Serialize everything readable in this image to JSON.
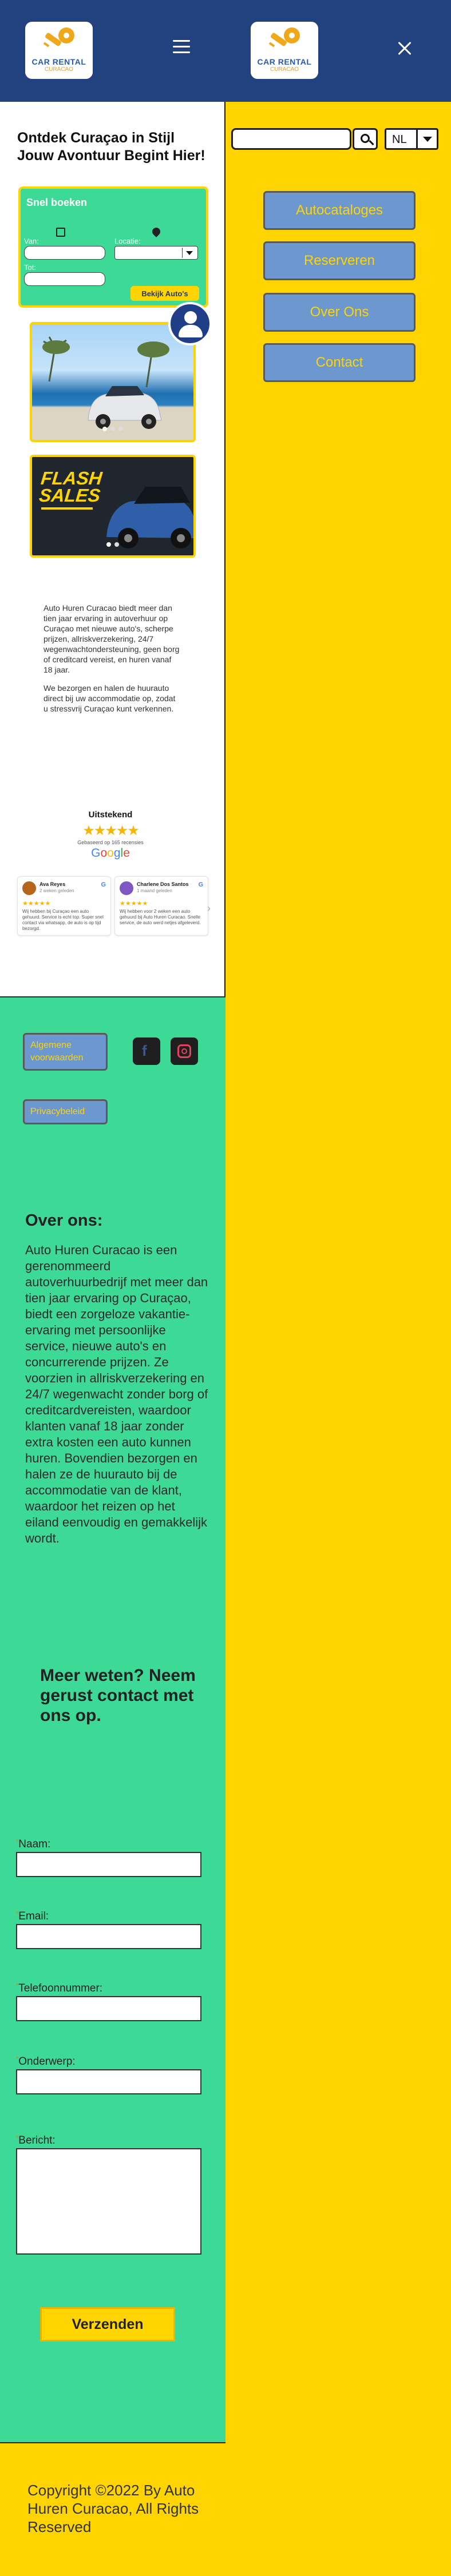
{
  "brand": {
    "name": "CAR RENTAL",
    "sub": "CURACAO"
  },
  "hero": {
    "title": "Ontdek Curaçao in Stijl Jouw Avontuur Begint Hier!"
  },
  "quick_book": {
    "title": "Snel boeken",
    "from_label": "Van:",
    "location_label": "Locatie:",
    "to_label": "Tot:",
    "button": "Bekijk Auto's"
  },
  "promo": {
    "flash_line1": "FLASH",
    "flash_line2": "SALES"
  },
  "about": {
    "p1": "Auto Huren Curacao biedt meer dan tien jaar ervaring in autoverhuur op Curaçao met nieuwe auto's, scherpe prijzen, allriskverzekering, 24/7 wegenwachtondersteuning, geen borg of creditcard vereist, en huren vanaf 18 jaar.",
    "p2": "We bezorgen en halen de huurauto direct bij uw accommodatie op, zodat u stressvrij Curaçao kunt verkennen."
  },
  "reviews": {
    "rating_label": "Uitstekend",
    "stars": "★★★★★",
    "based_on": "Gebaseerd op 165 recensies",
    "google": "Google",
    "items": [
      {
        "name": "Ava Reyes",
        "date": "2 weken geleden",
        "stars": "★★★★★",
        "text": "Wij hebben bij Curaçao een auto gehuurd. Service is echt top. Super snel contact via whatsapp, de auto is op tijd bezorgd.",
        "avatar_color": "#b5651d"
      },
      {
        "name": "Charlene Dos Santos",
        "date": "1 maand geleden",
        "stars": "★★★★★",
        "text": "Wij hebben voor 2 weken een auto gehuurd bij Auto Huren Curacao. Snelle service, de auto werd netjes afgeleverd.",
        "avatar_color": "#7e57c2"
      }
    ]
  },
  "footer_links": {
    "terms": "Algemene voorwaarden",
    "privacy": "Privacybeleid"
  },
  "over_ons": {
    "title": "Over ons:",
    "text": "Auto Huren Curacao is een gerenommeerd autoverhuurbedrijf met meer dan tien jaar ervaring op Curaçao, biedt een zorgeloze vakantie-ervaring met persoonlijke service, nieuwe auto's en concurrerende prijzen. Ze voorzien in allriskverzekering en 24/7 wegenwacht zonder borg of creditcardvereisten, waardoor klanten vanaf 18 jaar zonder extra kosten een auto kunnen huren. Bovendien bezorgen en halen ze de huurauto bij de accommodatie van de klant, waardoor het reizen op het eiland eenvoudig en gemakkelijk wordt."
  },
  "contact_form": {
    "title": "Meer weten? Neem gerust contact met ons op.",
    "req_mark": "*",
    "name_label": "Naam:",
    "email_label": "Email:",
    "phone_label": "Telefoonnummer:",
    "subject_label": "Onderwerp:",
    "message_label": "Bericht:",
    "submit": "Verzenden"
  },
  "copyright": "Copyright ©2022 By Auto Huren Curacao, All Rights Reserved",
  "menu": {
    "language": "NL",
    "items": [
      "Autocataloges",
      "Reserveren",
      "Over Ons",
      "Contact"
    ]
  },
  "colors": {
    "header": "#21417f",
    "accent": "#ffd400",
    "green": "#3dd996",
    "button": "#6c97cf"
  }
}
